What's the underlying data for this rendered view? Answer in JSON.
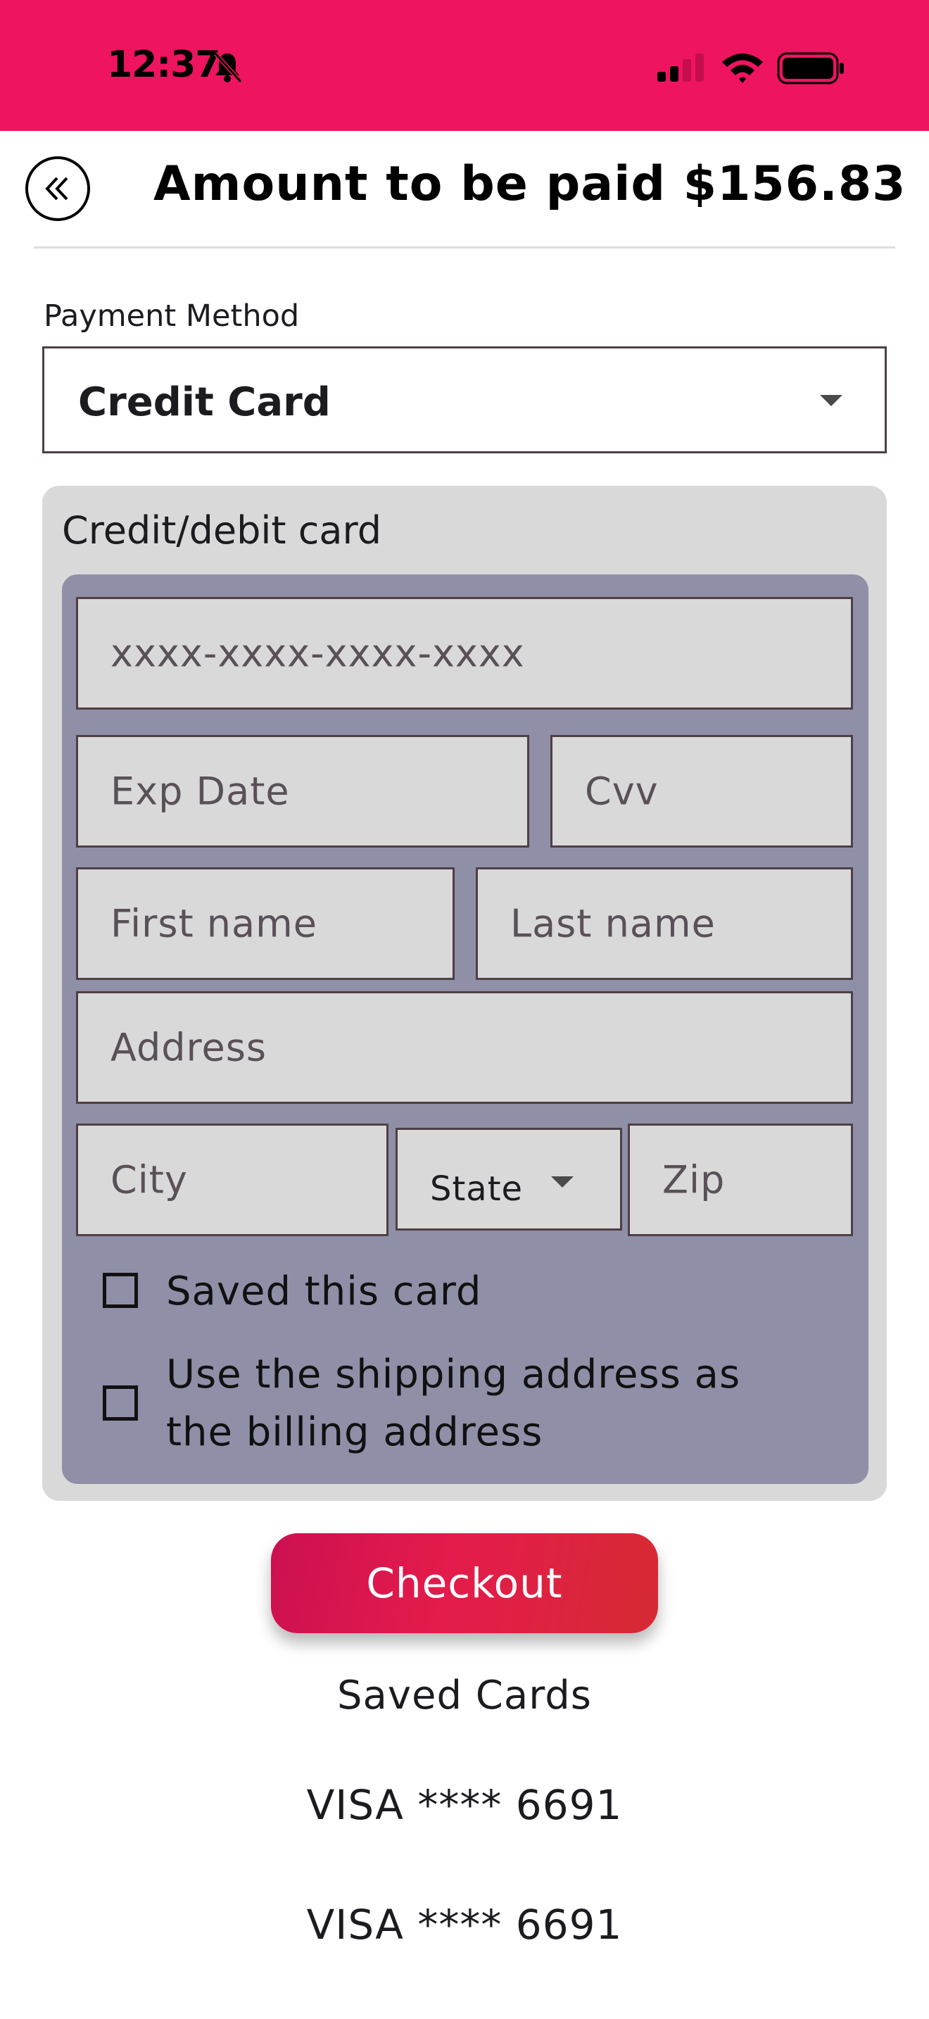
{
  "status_bar": {
    "time": "12:37",
    "background_color": "#ef145f",
    "icons": [
      "bell-slash-icon",
      "signal-icon",
      "wifi-icon",
      "battery-icon"
    ]
  },
  "header": {
    "back_icon": "double-chevron-left-icon",
    "title": "Amount to be paid $156.83"
  },
  "payment_method": {
    "label": "Payment Method",
    "selected": "Credit Card"
  },
  "card_form": {
    "title": "Credit/debit card",
    "card_number_placeholder": "xxxx-xxxx-xxxx-xxxx",
    "exp_date_placeholder": "Exp Date",
    "cvv_placeholder": "Cvv",
    "first_name_placeholder": "First name",
    "last_name_placeholder": "Last name",
    "address_placeholder": "Address",
    "city_placeholder": "City",
    "state_placeholder": "State",
    "zip_placeholder": "Zip",
    "save_card_label": "Saved this card",
    "save_card_checked": false,
    "use_shipping_label_line1": "Use the shipping address as",
    "use_shipping_label_line2": "the billing address",
    "use_shipping_checked": false
  },
  "checkout": {
    "label": "Checkout"
  },
  "saved_cards": {
    "title": "Saved Cards",
    "items": [
      "VISA **** 6691",
      "VISA **** 6691"
    ]
  },
  "colors": {
    "accent": "#ef145f",
    "panel": "#d9d9d9",
    "inner_panel": "#8f8fa8"
  }
}
